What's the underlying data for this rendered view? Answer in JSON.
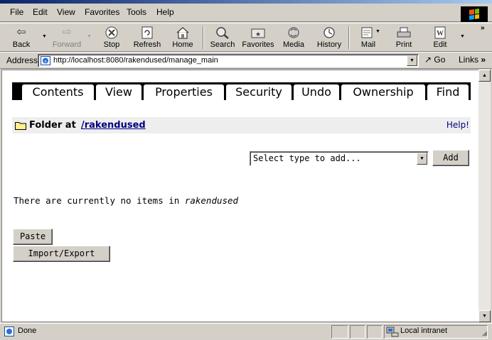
{
  "menu": [
    "File",
    "Edit",
    "View",
    "Favorites",
    "Tools",
    "Help"
  ],
  "toolbar": {
    "buttons": [
      {
        "label": "Back",
        "icon": "back-arrow-icon"
      },
      {
        "label": "Forward",
        "icon": "forward-arrow-icon"
      },
      {
        "label": "Stop",
        "icon": "stop-icon"
      },
      {
        "label": "Refresh",
        "icon": "refresh-icon"
      },
      {
        "label": "Home",
        "icon": "home-icon"
      },
      {
        "label": "Search",
        "icon": "search-icon"
      },
      {
        "label": "Favorites",
        "icon": "favorites-icon"
      },
      {
        "label": "Media",
        "icon": "media-icon"
      },
      {
        "label": "History",
        "icon": "history-icon"
      },
      {
        "label": "Mail",
        "icon": "mail-icon"
      },
      {
        "label": "Print",
        "icon": "print-icon"
      },
      {
        "label": "Edit",
        "icon": "edit-icon"
      }
    ]
  },
  "address": {
    "label": "Address",
    "url": "http://localhost:8080/rakendused/manage_main",
    "go_label": "Go",
    "links_label": "Links"
  },
  "tabs": [
    "Contents",
    "View",
    "Properties",
    "Security",
    "Undo",
    "Ownership",
    "Find"
  ],
  "folder": {
    "label": "Folder at",
    "path": "/rakendused",
    "help": "Help!"
  },
  "add": {
    "select_value": "Select type to add...",
    "button": "Add"
  },
  "message": {
    "prefix": "There are currently no items in ",
    "folder_name": "rakendused"
  },
  "actions": {
    "paste": "Paste",
    "import_export": "Import/Export"
  },
  "status": {
    "text": "Done",
    "zone": "Local intranet"
  }
}
